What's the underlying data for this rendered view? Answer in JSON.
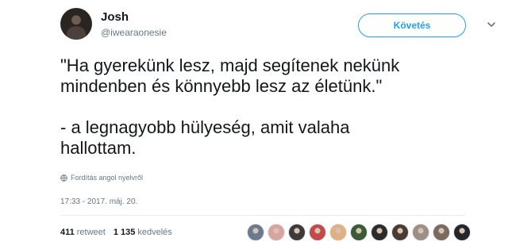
{
  "author": {
    "name": "Josh",
    "handle": "@iwearaonesie"
  },
  "follow_label": "Követés",
  "tweet": {
    "text": "\"Ha gyerekünk lesz, majd segítenek nekünk\nmindenben és könnyebb lesz az életünk.\"\n\n- a legnagyobb hülyeség, amit valaha\nhallottam.",
    "translate_label": "Fordítás angol nyelvről",
    "timestamp": "17:33 - 2017. máj. 20."
  },
  "stats": {
    "retweet_count": "411",
    "retweet_label": "retweet",
    "like_count": "1 135",
    "like_label": "kedvelés"
  },
  "liker_avatars": [
    {
      "color": "#6b7a8f"
    },
    {
      "color": "#d9a3a0"
    },
    {
      "color": "#3d3a3a"
    },
    {
      "color": "#c44a4a"
    },
    {
      "color": "#e0b083"
    },
    {
      "color": "#3c5a35"
    },
    {
      "color": "#2c2c2c"
    },
    {
      "color": "#4a3b33"
    },
    {
      "color": "#9c8f85"
    },
    {
      "color": "#7a6a60"
    },
    {
      "color": "#23262b"
    }
  ]
}
